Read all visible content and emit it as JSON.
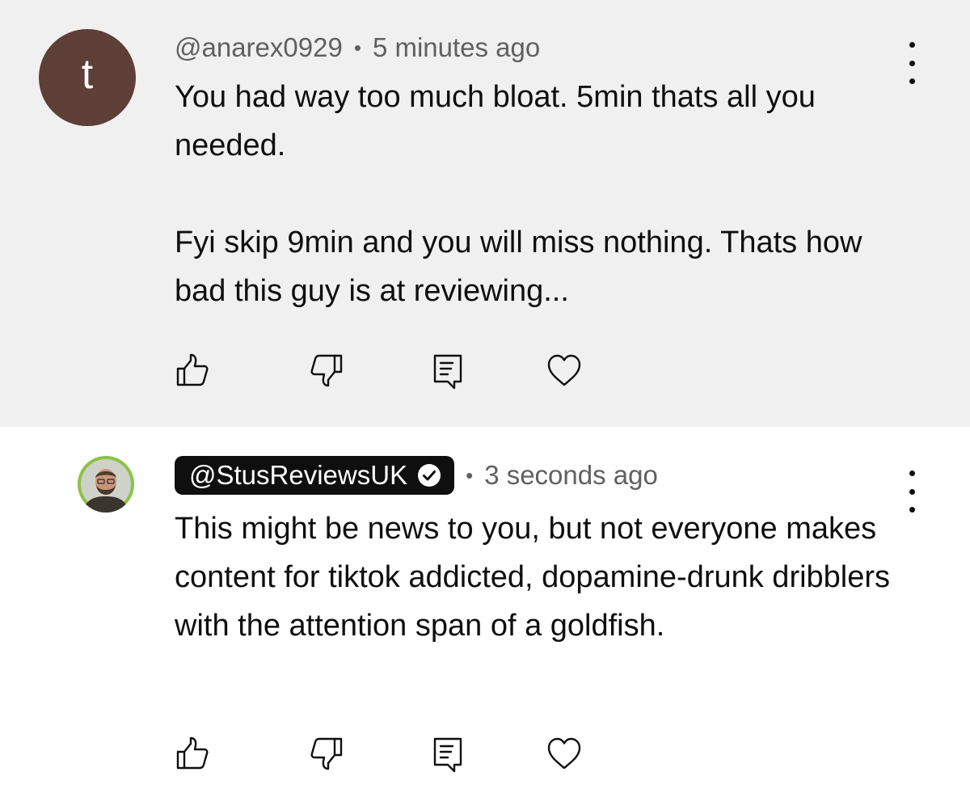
{
  "comments": [
    {
      "avatar_letter": "t",
      "avatar_color": "#5d3f37",
      "username": "@anarex0929",
      "separator": "•",
      "time": "5 minutes ago",
      "paragraphs": [
        "You had way too much bloat. 5min thats all you needed.",
        "Fyi skip 9min and you will miss nothing. Thats how bad this guy is at reviewing..."
      ]
    },
    {
      "username": "@StusReviewsUK",
      "verified": true,
      "separator": "•",
      "time": "3 seconds ago",
      "avatar_color": "#8bc34a",
      "paragraphs": [
        "This might be news to you, but not everyone makes content for tiktok addicted, dopamine-drunk dribblers with the attention span of a goldfish."
      ]
    }
  ],
  "icons": {
    "like": "thumbs-up-icon",
    "dislike": "thumbs-down-icon",
    "reply": "reply-icon",
    "heart": "heart-icon",
    "menu": "more-vertical-icon",
    "verified": "verified-check-icon"
  },
  "colors": {
    "highlight_background": "#f0f0f0",
    "meta_text": "#606060",
    "badge_background": "#0f0f0f"
  }
}
